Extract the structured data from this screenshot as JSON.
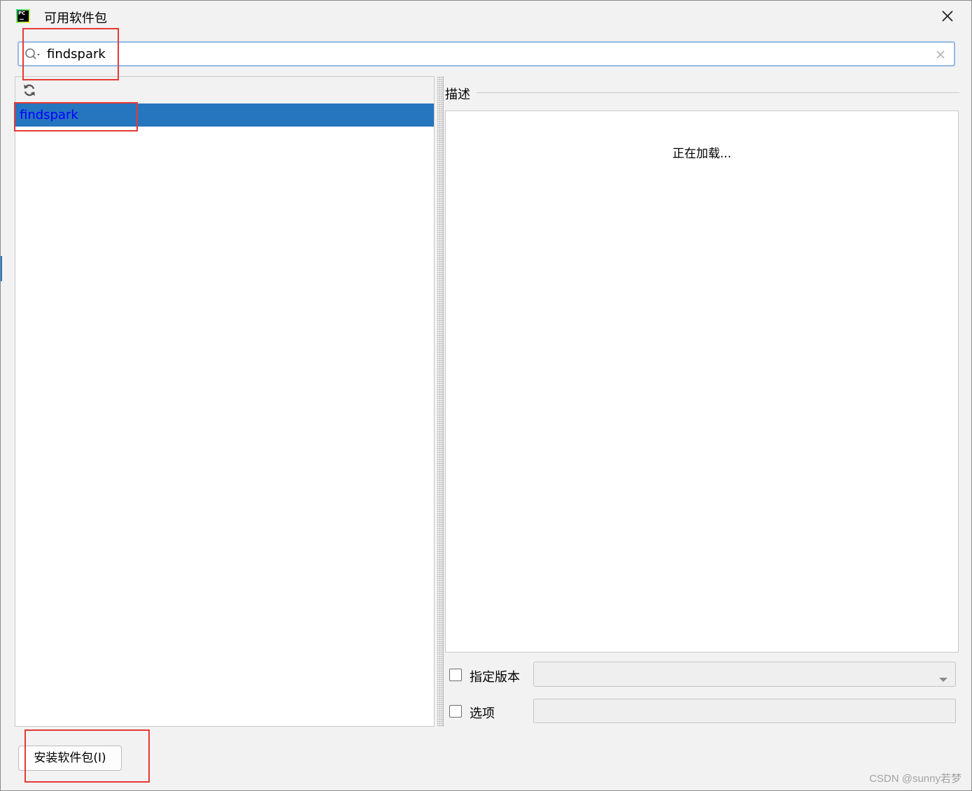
{
  "window": {
    "title": "可用软件包",
    "app_icon_text": "PC"
  },
  "search": {
    "value": "findspark"
  },
  "packages": [
    {
      "name": "findspark",
      "selected": true
    }
  ],
  "description": {
    "label": "描述",
    "loading_text": "正在加载..."
  },
  "options": {
    "specify_version_label": "指定版本",
    "specify_version_checked": false,
    "options_label": "选项",
    "options_checked": false,
    "version_value": "",
    "options_value": ""
  },
  "install_button_label": "安装软件包(I)",
  "watermark": "CSDN @sunny若梦",
  "colors": {
    "selection": "#2675bf",
    "selected_text": "#0000ff",
    "annotation": "#e53935",
    "search_border": "#93b9e6"
  }
}
